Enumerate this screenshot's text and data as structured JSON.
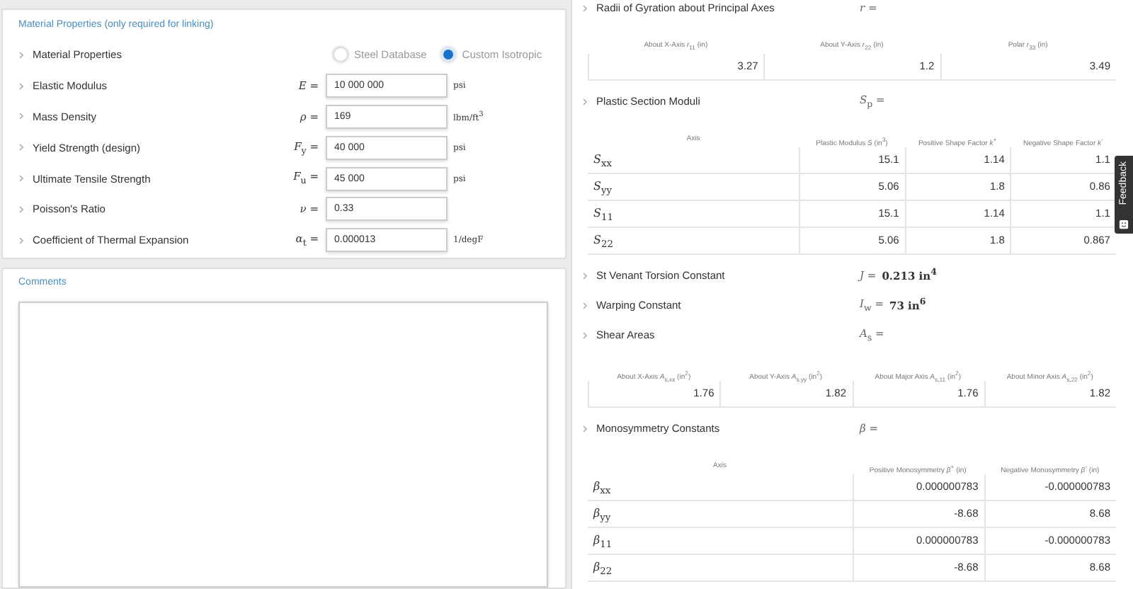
{
  "material_card": {
    "title": "Material Properties (only required for linking)",
    "rows": [
      {
        "kind": "radio",
        "label": "Material Properties",
        "options": [
          {
            "label": "Steel Database",
            "selected": false
          },
          {
            "label": "Custom Isotropic",
            "selected": true
          }
        ]
      },
      {
        "kind": "input",
        "label": "Elastic Modulus",
        "symbol": "*E* =",
        "value": "10 000 000",
        "unit": "psi"
      },
      {
        "kind": "input",
        "label": "Mass Density",
        "symbol": "*ρ* =",
        "value": "169",
        "unit": "lbm/ft$^{3}$"
      },
      {
        "kind": "input",
        "label": "Yield Strength (design)",
        "symbol": "*F*$_{y}$ =",
        "value": "40 000",
        "unit": "psi"
      },
      {
        "kind": "input",
        "label": "Ultimate Tensile Strength",
        "symbol": "*F*$_{u}$ =",
        "value": "45 000",
        "unit": "psi"
      },
      {
        "kind": "input",
        "label": "Poisson's Ratio",
        "symbol": "*ν* =",
        "value": "0.33"
      },
      {
        "kind": "input",
        "label": "Coefficient of Thermal Expansion",
        "symbol": "*α*$_{t}$ =",
        "value": "0.000013",
        "unit": "1/degF"
      }
    ]
  },
  "comments": {
    "title": "Comments"
  },
  "results": {
    "sections": [
      {
        "kind": "table",
        "label": "Radii of Gyration about Principal Axes",
        "symbol": "*r* =",
        "table": {
          "kind": "values",
          "columns": [
            "About X-Axis *r*$_{11}$ (in)",
            "About Y-Axis *r*$_{22}$ (in)",
            "Polar *r*$_{33}$ (in)"
          ],
          "rows": [
            [
              "3.27",
              "1.2",
              "3.49"
            ]
          ]
        }
      },
      {
        "kind": "table",
        "label": "Plastic Section Moduli",
        "symbol": "*S*$_{p}$ =",
        "table": {
          "kind": "axis",
          "columns": [
            "Axis",
            "Plastic Modulus *S* (in$^{3}$)",
            "Positive Shape Factor *k*$^{+}$",
            "Negative Shape Factor *k*$^{-}$"
          ],
          "rows": [
            [
              "*S*$_{xx}$",
              "15.1",
              "1.14",
              "1.1"
            ],
            [
              "*S*$_{yy}$",
              "5.06",
              "1.8",
              "0.86"
            ],
            [
              "*S*$_{11}$",
              "15.1",
              "1.14",
              "1.1"
            ],
            [
              "*S*$_{22}$",
              "5.06",
              "1.8",
              "0.867"
            ]
          ]
        }
      },
      {
        "kind": "value",
        "label": "St Venant Torsion Constant",
        "symbol": "*J* =",
        "value": "0.213 in$^{4}$"
      },
      {
        "kind": "value",
        "label": "Warping Constant",
        "symbol": "*I*$_{w}$ =",
        "value": "73 in$^{6}$"
      },
      {
        "kind": "table",
        "label": "Shear Areas",
        "symbol": "*A*$_{s}$ =",
        "table": {
          "kind": "values",
          "columns": [
            "About X-Axis *A*$_{s,xx}$ (in$^{2}$)",
            "About Y-Axis *A*$_{s,yy}$ (in$^{2}$)",
            "About Major Axis *A*$_{s,11}$ (in$^{2}$)",
            "About Minor Axis *A*$_{s,22}$ (in$^{2}$)"
          ],
          "rows": [
            [
              "1.76",
              "1.82",
              "1.76",
              "1.82"
            ]
          ]
        }
      },
      {
        "kind": "table",
        "label": "Monosymmetry Constants",
        "symbol": "*β* =",
        "table": {
          "kind": "axis",
          "columns": [
            "Axis",
            "Positive Monosymmetry *β*$^{+}$ (in)",
            "Negative Monosymmetry *β*$^{-}$ (in)"
          ],
          "rows": [
            [
              "*β*$_{xx}$",
              "0.000000783",
              "-0.000000783"
            ],
            [
              "*β*$_{yy}$",
              "-8.68",
              "8.68"
            ],
            [
              "*β*$_{11}$",
              "0.000000783",
              "-0.000000783"
            ],
            [
              "*β*$_{22}$",
              "-8.68",
              "8.68"
            ]
          ]
        }
      }
    ]
  },
  "feedback_tab": {
    "label": "Feedback"
  }
}
